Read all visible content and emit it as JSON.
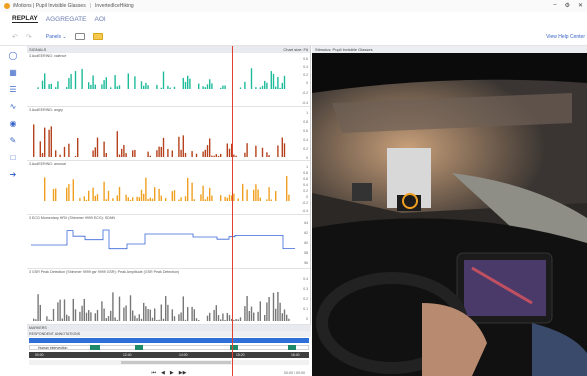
{
  "titlebar": {
    "app": "iMotions | Pupil Invisible Glasses",
    "separator": "|",
    "study": "InvertedIceHiking"
  },
  "tabs": [
    {
      "label": "REPLAY"
    },
    {
      "label": "AGGREGATE"
    },
    {
      "label": "AOI"
    }
  ],
  "toolbar": {
    "panels_label": "Panels",
    "help_label": "View Help Center"
  },
  "signals": {
    "header": "SIGNALS",
    "chart_size": "Chart size: Fit",
    "tracks": [
      {
        "label": "3 AudEERING: valence",
        "ticks": [
          "0.6",
          "0.4",
          "0.2",
          "0",
          "-0.2",
          "-0.4"
        ]
      },
      {
        "label": "3 AudEERING: angry",
        "ticks": [
          "1",
          "0.8",
          "0.6",
          "0.4",
          "0.2",
          "0"
        ]
      },
      {
        "label": "3 AudEERING: arousal",
        "ticks": [
          "1",
          "0.8",
          "0.6",
          "0.4",
          "0.2",
          "0",
          "-0.2",
          "-0.4"
        ]
      },
      {
        "label": "3 ECG Momentary HRV (Shimmer 9999 ECG): SDNN",
        "ticks": [
          "64",
          "62",
          "60",
          "58",
          "56"
        ]
      },
      {
        "label": "3 GSR Peak Detection (Shimmer 9999 gsr 9999 GSR): Peak Amplitude (GSR Peak Detection)",
        "ticks": [
          "0.4",
          "0.3",
          "0.2",
          "0.1",
          "0"
        ]
      }
    ]
  },
  "markers": {
    "header": "MARKERS",
    "annotations_header": "RESPONDENT ANNOTATIONS",
    "human_label": "Human intervention",
    "time_labels": [
      "00:00",
      "12:40",
      "14:00",
      "15:20",
      "16:40"
    ]
  },
  "player": {
    "time": "00:00 / 00:00"
  },
  "video": {
    "title": "Stimulus: Pupil Invisible Glasses"
  },
  "colors": {
    "valence": "#1dbb9a",
    "angry": "#b5421c",
    "arousal": "#f0a020",
    "hrv": "#3a66d8",
    "gsr": "#777777",
    "cursor": "#e04030"
  }
}
